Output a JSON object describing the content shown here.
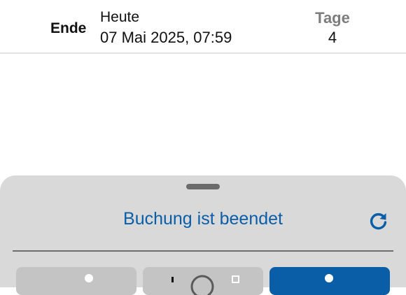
{
  "booking_end": {
    "label": "Ende",
    "day": "Heute",
    "datetime": "07 Mai 2025, 07:59",
    "days_label": "Tage",
    "days_value": "4"
  },
  "status_sheet": {
    "title": "Buchung ist beendet",
    "accent_color": "#0a5ea8"
  },
  "icons": {
    "refresh": "refresh-icon",
    "action_1": "person-icon",
    "action_2": "lock-icon",
    "action_3": "person-icon"
  }
}
